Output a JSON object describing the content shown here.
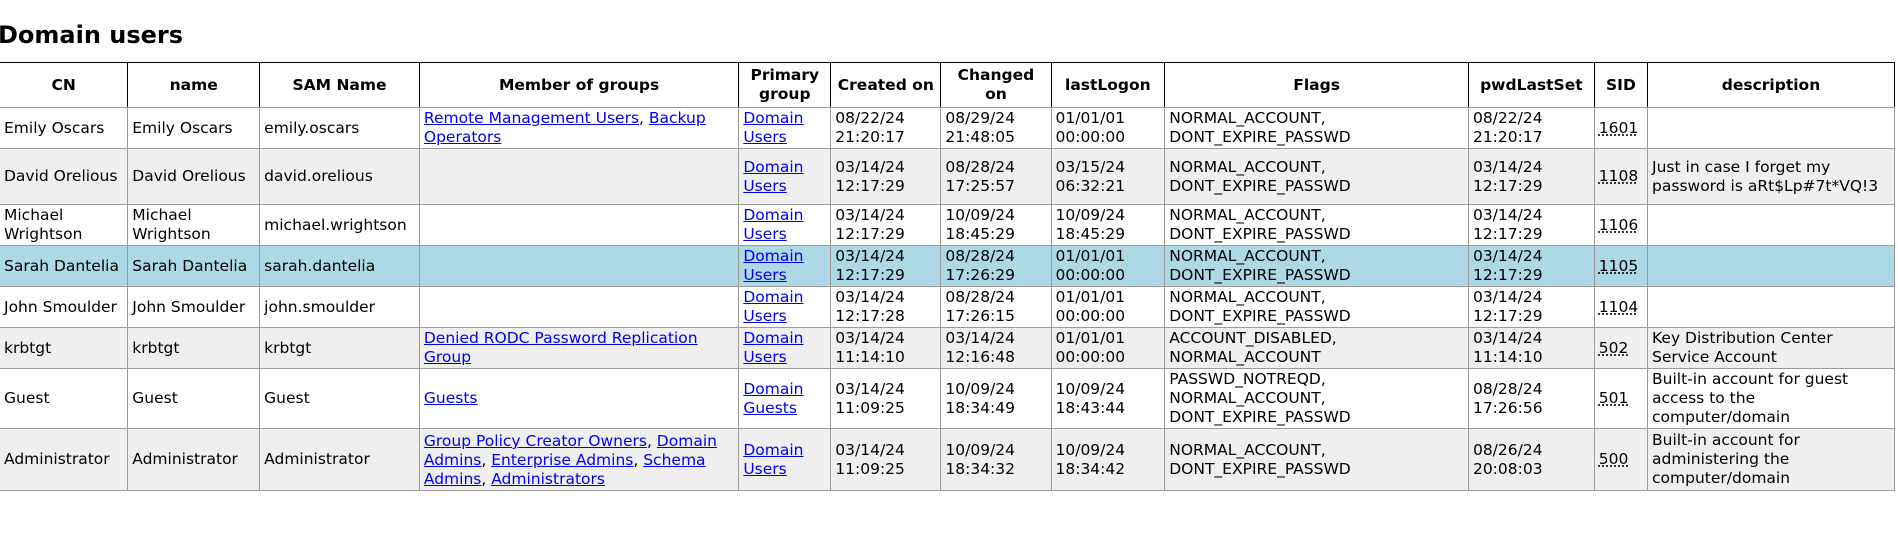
{
  "page": {
    "title": "Domain users"
  },
  "table": {
    "headers": {
      "cn": "CN",
      "name": "name",
      "sam": "SAM Name",
      "groups": "Member of groups",
      "primary_line1": "Primary",
      "primary_line2": "group",
      "created": "Created on",
      "changed_line1": "Changed",
      "changed_line2": "on",
      "lastlogon": "lastLogon",
      "flags": "Flags",
      "pwdlastset": "pwdLastSet",
      "sid": "SID",
      "description": "description"
    },
    "rows": [
      {
        "cn": "Emily Oscars",
        "name": "Emily Oscars",
        "sam": "emily.oscars",
        "groups": [
          "Remote Management Users",
          "Backup Operators"
        ],
        "primary_line1": "Domain",
        "primary_line2": "Users",
        "created_date": "08/22/24",
        "created_time": "21:20:17",
        "changed_date": "08/29/24",
        "changed_time": "21:48:05",
        "lastlogon_date": "01/01/01",
        "lastlogon_time": "00:00:00",
        "flags_line1": "NORMAL_ACCOUNT,",
        "flags_line2": "DONT_EXPIRE_PASSWD",
        "flags_line3": "",
        "pwd_date": "08/22/24",
        "pwd_time": "21:20:17",
        "sid": "1601",
        "description": ""
      },
      {
        "cn": "David Orelious",
        "name": "David Orelious",
        "sam": "david.orelious",
        "groups": [],
        "primary_line1": "Domain",
        "primary_line2": "Users",
        "created_date": "03/14/24",
        "created_time": "12:17:29",
        "changed_date": "08/28/24",
        "changed_time": "17:25:57",
        "lastlogon_date": "03/15/24",
        "lastlogon_time": "06:32:21",
        "flags_line1": "NORMAL_ACCOUNT,",
        "flags_line2": "DONT_EXPIRE_PASSWD",
        "flags_line3": "",
        "pwd_date": "03/14/24",
        "pwd_time": "12:17:29",
        "sid": "1108",
        "description": "Just in case I forget my password is aRt$Lp#7t*VQ!3"
      },
      {
        "cn": "Michael Wrightson",
        "name": "Michael Wrightson",
        "sam": "michael.wrightson",
        "groups": [],
        "primary_line1": "Domain",
        "primary_line2": "Users",
        "created_date": "03/14/24",
        "created_time": "12:17:29",
        "changed_date": "10/09/24",
        "changed_time": "18:45:29",
        "lastlogon_date": "10/09/24",
        "lastlogon_time": "18:45:29",
        "flags_line1": "NORMAL_ACCOUNT,",
        "flags_line2": "DONT_EXPIRE_PASSWD",
        "flags_line3": "",
        "pwd_date": "03/14/24",
        "pwd_time": "12:17:29",
        "sid": "1106",
        "description": ""
      },
      {
        "cn": "Sarah Dantelia",
        "name": "Sarah Dantelia",
        "sam": "sarah.dantelia",
        "groups": [],
        "primary_line1": "Domain",
        "primary_line2": "Users",
        "created_date": "03/14/24",
        "created_time": "12:17:29",
        "changed_date": "08/28/24",
        "changed_time": "17:26:29",
        "lastlogon_date": "01/01/01",
        "lastlogon_time": "00:00:00",
        "flags_line1": "NORMAL_ACCOUNT,",
        "flags_line2": "DONT_EXPIRE_PASSWD",
        "flags_line3": "",
        "pwd_date": "03/14/24",
        "pwd_time": "12:17:29",
        "sid": "1105",
        "description": ""
      },
      {
        "cn": "John Smoulder",
        "name": "John Smoulder",
        "sam": "john.smoulder",
        "groups": [],
        "primary_line1": "Domain",
        "primary_line2": "Users",
        "created_date": "03/14/24",
        "created_time": "12:17:28",
        "changed_date": "08/28/24",
        "changed_time": "17:26:15",
        "lastlogon_date": "01/01/01",
        "lastlogon_time": "00:00:00",
        "flags_line1": "NORMAL_ACCOUNT,",
        "flags_line2": "DONT_EXPIRE_PASSWD",
        "flags_line3": "",
        "pwd_date": "03/14/24",
        "pwd_time": "12:17:29",
        "sid": "1104",
        "description": ""
      },
      {
        "cn": "krbtgt",
        "name": "krbtgt",
        "sam": "krbtgt",
        "groups": [
          "Denied RODC Password Replication Group"
        ],
        "primary_line1": "Domain",
        "primary_line2": "Users",
        "created_date": "03/14/24",
        "created_time": "11:14:10",
        "changed_date": "03/14/24",
        "changed_time": "12:16:48",
        "lastlogon_date": "01/01/01",
        "lastlogon_time": "00:00:00",
        "flags_line1": "ACCOUNT_DISABLED,",
        "flags_line2": "NORMAL_ACCOUNT",
        "flags_line3": "",
        "pwd_date": "03/14/24",
        "pwd_time": "11:14:10",
        "sid": "502",
        "description": "Key Distribution Center Service Account"
      },
      {
        "cn": "Guest",
        "name": "Guest",
        "sam": "Guest",
        "groups": [
          "Guests"
        ],
        "primary_line1": "Domain",
        "primary_line2": "Guests",
        "created_date": "03/14/24",
        "created_time": "11:09:25",
        "changed_date": "10/09/24",
        "changed_time": "18:34:49",
        "lastlogon_date": "10/09/24",
        "lastlogon_time": "18:43:44",
        "flags_line1": "PASSWD_NOTREQD,",
        "flags_line2": "NORMAL_ACCOUNT,",
        "flags_line3": "DONT_EXPIRE_PASSWD",
        "pwd_date": "08/28/24",
        "pwd_time": "17:26:56",
        "sid": "501",
        "description": "Built-in account for guest access to the computer/domain"
      },
      {
        "cn": "Administrator",
        "name": "Administrator",
        "sam": "Administrator",
        "groups": [
          "Group Policy Creator Owners",
          "Domain Admins",
          "Enterprise Admins",
          "Schema Admins",
          "Administrators"
        ],
        "primary_line1": "Domain",
        "primary_line2": "Users",
        "created_date": "03/14/24",
        "created_time": "11:09:25",
        "changed_date": "10/09/24",
        "changed_time": "18:34:32",
        "lastlogon_date": "10/09/24",
        "lastlogon_time": "18:34:42",
        "flags_line1": "NORMAL_ACCOUNT,",
        "flags_line2": "DONT_EXPIRE_PASSWD",
        "flags_line3": "",
        "pwd_date": "08/26/24",
        "pwd_time": "20:08:03",
        "sid": "500",
        "description": "Built-in account for administering the computer/domain"
      }
    ]
  },
  "colors": {
    "row_alt": "#efefef",
    "row_selected": "#add8e6",
    "link": "#0000ee"
  }
}
